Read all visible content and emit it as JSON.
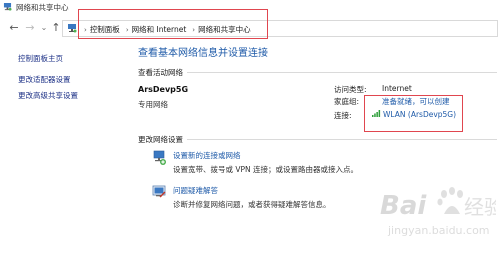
{
  "window": {
    "title": "网络和共享中心"
  },
  "address_bar": {
    "crumbs": [
      "控制面板",
      "网络和 Internet",
      "网络和共享中心"
    ],
    "back_glyph": "←",
    "forward_glyph": "→",
    "up_glyph": "↑"
  },
  "sidebar": {
    "items": [
      {
        "label": "控制面板主页"
      },
      {
        "label": "更改适配器设置"
      },
      {
        "label": "更改高级共享设置"
      }
    ]
  },
  "main": {
    "title": "查看基本网络信息并设置连接",
    "active_networks_label": "查看活动网络",
    "network": {
      "name": "ArsDevp5G",
      "type": "专用网络",
      "access_type_key": "访问类型:",
      "access_type_value": "Internet",
      "homegroup_key": "家庭组:",
      "homegroup_value": "准备就绪，可以创建",
      "connection_key": "连接:",
      "connection_value": "WLAN (ArsDevp5G)"
    },
    "change_settings_label": "更改网络设置",
    "tasks": [
      {
        "title": "设置新的连接或网络",
        "desc": "设置宽带、拨号或 VPN 连接；或设置路由器或接入点。"
      },
      {
        "title": "问题疑难解答",
        "desc": "诊断并修复网络问题，或者获得疑难解答信息。"
      }
    ]
  },
  "watermark": {
    "text": "Baidu 经验",
    "url_text": "jingyan.baidu.com"
  },
  "colors": {
    "link": "#1e5aa8",
    "highlight_box": "#e0464f"
  }
}
